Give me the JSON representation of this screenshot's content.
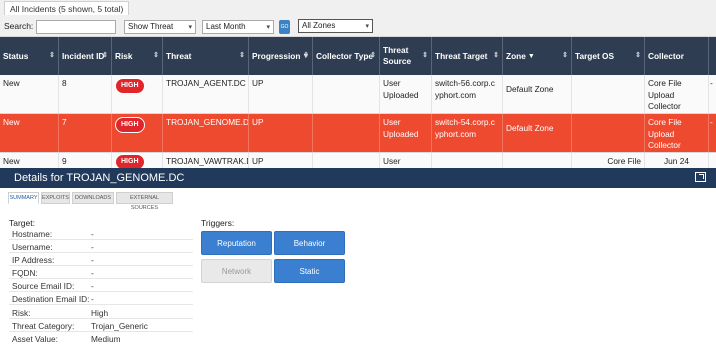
{
  "tab_label": "All Incidents (5 shown, 5 total)",
  "filters": {
    "search_label": "Search:",
    "search_value": "",
    "threat_filter": "Show Threat",
    "period_filter": "Last Month",
    "zone_filter": "All Zones",
    "go_label": "GO"
  },
  "columns": [
    "Status",
    "Incident ID",
    "Risk",
    "Threat",
    "Progression",
    "Collector Type",
    "Threat Source",
    "Threat Target",
    "Zone",
    "Target OS",
    "Collector"
  ],
  "rows": [
    {
      "status": "New",
      "id": "8",
      "risk": "HIGH",
      "threat": "TROJAN_AGENT.DC",
      "progression": "UP",
      "collector_type": "",
      "source": "User Uploaded",
      "target": "switch-56.corp.cyphort.com",
      "zone": "Default Zone",
      "os": "",
      "collector": "Core File Upload Collector",
      "extra": "-"
    },
    {
      "status": "New",
      "id": "7",
      "risk": "HIGH",
      "threat": "TROJAN_GENOME.DC",
      "progression": "UP",
      "collector_type": "",
      "source": "User Uploaded",
      "target": "switch-54.corp.cyphort.com",
      "zone": "Default Zone",
      "os": "",
      "collector": "Core File Upload Collector",
      "extra": "-"
    },
    {
      "status": "New",
      "id": "9",
      "risk": "HIGH",
      "threat": "TROJAN_VAWTRAK.DC",
      "progression": "UP",
      "collector_type": "",
      "source": "User",
      "target": "",
      "zone": "",
      "os": "Core File",
      "collector": "Jun 24",
      "extra": ""
    }
  ],
  "details": {
    "title": "Details for TROJAN_GENOME.DC",
    "tabs": [
      "SUMMARY",
      "EXPLOITS",
      "DOWNLOADS",
      "EXTERNAL SOURCES"
    ],
    "target_title": "Target:",
    "fields": [
      {
        "k": "Hostname:",
        "v": "-"
      },
      {
        "k": "Username:",
        "v": "-"
      },
      {
        "k": "IP Address:",
        "v": "-"
      },
      {
        "k": "FQDN:",
        "v": "-"
      },
      {
        "k": "Source Email ID:",
        "v": "-"
      },
      {
        "k": "Destination Email ID:",
        "v": "-"
      },
      {
        "k": "Risk:",
        "v": "High"
      },
      {
        "k": "Threat Category:",
        "v": "Trojan_Generic"
      },
      {
        "k": "Asset Value:",
        "v": "Medium"
      }
    ],
    "triggers_title": "Triggers:",
    "triggers": [
      {
        "label": "Reputation",
        "active": true
      },
      {
        "label": "Behavior",
        "active": true
      },
      {
        "label": "Network",
        "active": false
      },
      {
        "label": "Static",
        "active": true
      }
    ]
  },
  "colors": {
    "header": "#2e3d52",
    "selected_row": "#ee4a30",
    "risk_badge": "#e0262a",
    "details_header": "#213a5c",
    "trigger_button": "#3a7fd0"
  }
}
